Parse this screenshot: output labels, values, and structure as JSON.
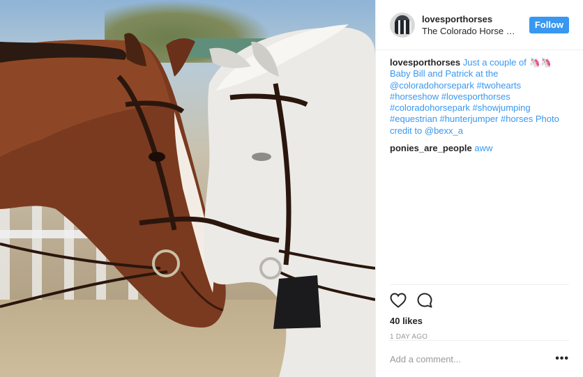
{
  "header": {
    "username": "lovesporthorses",
    "location": "The Colorado Horse …",
    "follow_label": "Follow"
  },
  "caption": {
    "username": "lovesporthorses",
    "text_1": "Just a couple of",
    "emoji": "🦄🦄",
    "text_2": "Baby Bill and Patrick at the",
    "mention_park": "@coloradohorsepark",
    "tags_1": "#twohearts #horseshow #lovesporthorses",
    "tags_2": "#coloradohorsepark #showjumping",
    "tags_3": "#equestrian #hunterjumper #horses",
    "credit_text": "Photo credit to",
    "credit_user": "@bexx_a"
  },
  "comments": [
    {
      "username": "ponies_are_people",
      "text": "aww"
    }
  ],
  "stats": {
    "likes": "40 likes",
    "time_ago": "1 DAY AGO"
  },
  "add_comment": {
    "placeholder": "Add a comment..."
  },
  "icons": {
    "like": "heart-icon",
    "comment": "speech-bubble-icon",
    "more": "more-options-icon"
  },
  "colors": {
    "accent": "#3897f0",
    "text": "#262626",
    "muted": "#999999"
  }
}
